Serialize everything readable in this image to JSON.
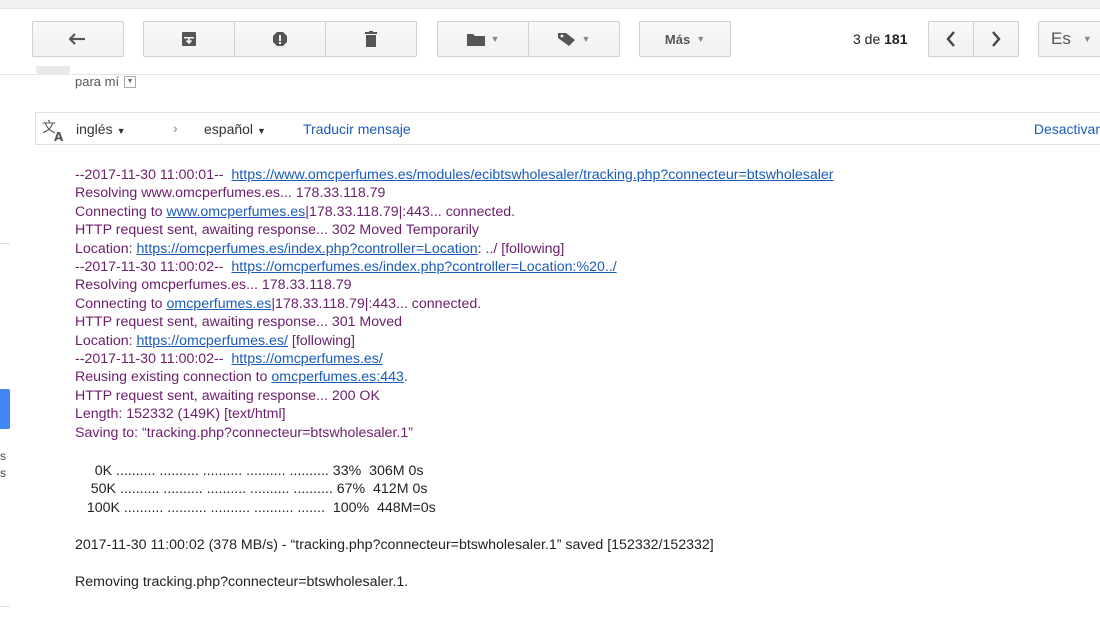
{
  "toolbar": {
    "more_label": "Más",
    "pager_prefix": "3 de",
    "pager_total": "181",
    "language_button": "Es"
  },
  "icons": [
    "back-icon",
    "archive-icon",
    "spam-icon",
    "trash-icon",
    "folder-icon",
    "label-icon",
    "chevron-left-icon",
    "chevron-right-icon",
    "translate-icon"
  ],
  "recipient": {
    "label": "para mí"
  },
  "translate_bar": {
    "from_lang": "inglés",
    "to_lang": "español",
    "translate_link": "Traducir mensaje",
    "deactivate_link": "Desactivar"
  },
  "left_gutter": {
    "line1": "s",
    "line2": "s"
  },
  "log": {
    "l1_prefix": "--2017-11-30 11:00:01--  ",
    "l1_link": "https://www.omcperfumes.es/modules/ecibtswholesaler/tracking.php?connecteur=btswholesaler",
    "l2": "Resolving www.omcperfumes.es... 178.33.118.79",
    "l3_prefix": "Connecting to ",
    "l3_link": "www.omcperfumes.es",
    "l3_suffix": "|178.33.118.79|:443... connected.",
    "l4": "HTTP request sent, awaiting response... 302 Moved Temporarily",
    "l5_prefix": "Location: ",
    "l5_link": "https://omcperfumes.es/index.php?controller=Location",
    "l5_suffix": ": ../ [following]",
    "l6_prefix": "--2017-11-30 11:00:02--  ",
    "l6_link": "https://omcperfumes.es/index.php?controller=Location:%20../",
    "l7": "Resolving omcperfumes.es... 178.33.118.79",
    "l8_prefix": "Connecting to ",
    "l8_link": "omcperfumes.es",
    "l8_suffix": "|178.33.118.79|:443... connected.",
    "l9": "HTTP request sent, awaiting response... 301 Moved",
    "l10_prefix": "Location: ",
    "l10_link": "https://omcperfumes.es/",
    "l10_suffix": " [following]",
    "l11_prefix": "--2017-11-30 11:00:02--  ",
    "l11_link": "https://omcperfumes.es/",
    "l12_prefix": "Reusing existing connection to ",
    "l12_link": "omcperfumes.es:443",
    "l12_suffix": ".",
    "l13": "HTTP request sent, awaiting response... 200 OK",
    "l14": "Length: 152332 (149K) [text/html]",
    "l15": "Saving to: “tracking.php?connecteur=btswholesaler.1”",
    "p1": "     0K .......... .......... .......... .......... .......... 33%  306M 0s",
    "p2": "    50K .......... .......... .......... .......... .......... 67%  412M 0s",
    "p3": "   100K .......... .......... .......... .......... .......  100%  448M=0s",
    "saved": "2017-11-30 11:00:02 (378 MB/s) - “tracking.php?connecteur=btswholesaler.1” saved [152332/152332]",
    "removing": "Removing tracking.php?connecteur=btswholesaler.1."
  }
}
